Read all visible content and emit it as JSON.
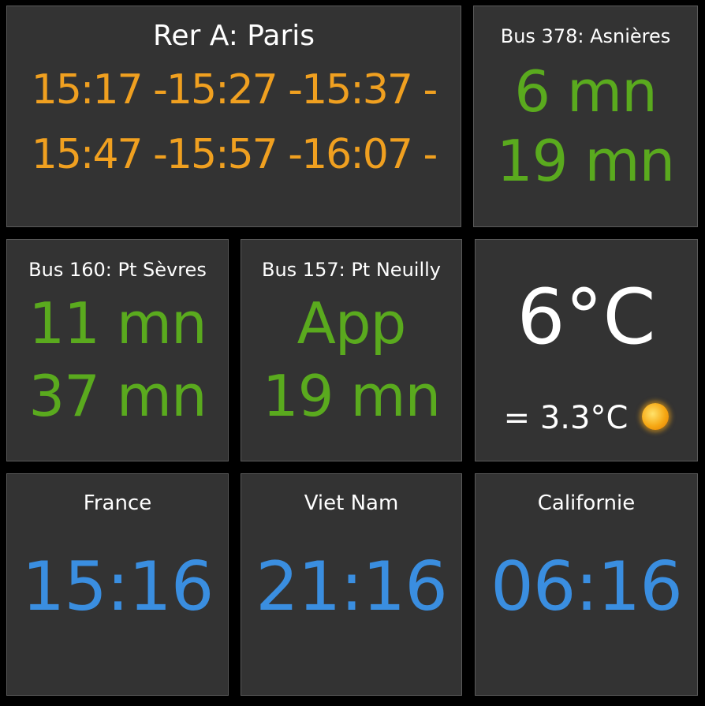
{
  "tiles": {
    "rer_a": {
      "title": "Rer A: Paris",
      "times_row1": "15:17 -15:27 -15:37 -",
      "times_row2": "15:47 -15:57 -16:07 -"
    },
    "bus_378": {
      "title": "Bus 378: Asnières",
      "next1": "6 mn",
      "next2": "19 mn"
    },
    "bus_160": {
      "title": "Bus 160: Pt Sèvres",
      "next1": "11 mn",
      "next2": "37 mn"
    },
    "bus_157": {
      "title": "Bus 157: Pt Neuilly",
      "next1": "App",
      "next2": "19 mn"
    },
    "weather": {
      "temperature": "6°C",
      "feels_like": "= 3.3°C",
      "icon": "sun-icon"
    },
    "clock_france": {
      "label": "France",
      "time": "15:16"
    },
    "clock_vietnam": {
      "label": "Viet Nam",
      "time": "21:16"
    },
    "clock_california": {
      "label": "Californie",
      "time": "06:16"
    }
  },
  "colors": {
    "background": "#000000",
    "tile": "#333333",
    "rer_times": "#f0a020",
    "bus_times": "#5aaa1e",
    "clock_times": "#3a8ee0",
    "text": "#ffffff"
  }
}
